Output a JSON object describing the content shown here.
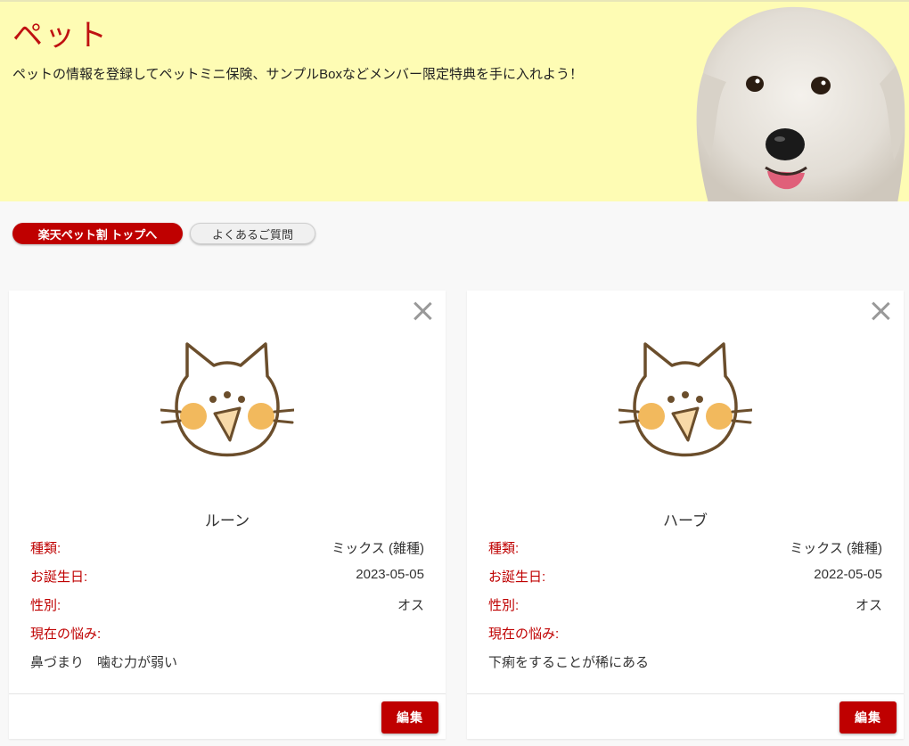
{
  "hero": {
    "title": "ペット",
    "description": "ペットの情報を登録してペットミニ保険、サンプルBoxなどメンバー限定特典を手に入れよう！"
  },
  "nav": {
    "primary_label": "楽天ペット割 トップへ",
    "faq_label": "よくあるご質問"
  },
  "labels": {
    "breed": "種類:",
    "birthday": "お誕生日:",
    "sex": "性別:",
    "concern": "現在の悩み:",
    "edit": "編集"
  },
  "pets": [
    {
      "name": "ルーン",
      "breed": "ミックス (雑種)",
      "birthday": "2023-05-05",
      "sex": "オス",
      "concern": "鼻づまり　噛む力が弱い"
    },
    {
      "name": "ハーブ",
      "breed": "ミックス (雑種)",
      "birthday": "2022-05-05",
      "sex": "オス",
      "concern": "下痢をすることが稀にある"
    }
  ],
  "colors": {
    "accent": "#bf0000",
    "hero_bg": "#fefcb4",
    "page_bg": "#f8f8f8"
  },
  "icons": [
    "close-icon",
    "cat-face-icon"
  ]
}
